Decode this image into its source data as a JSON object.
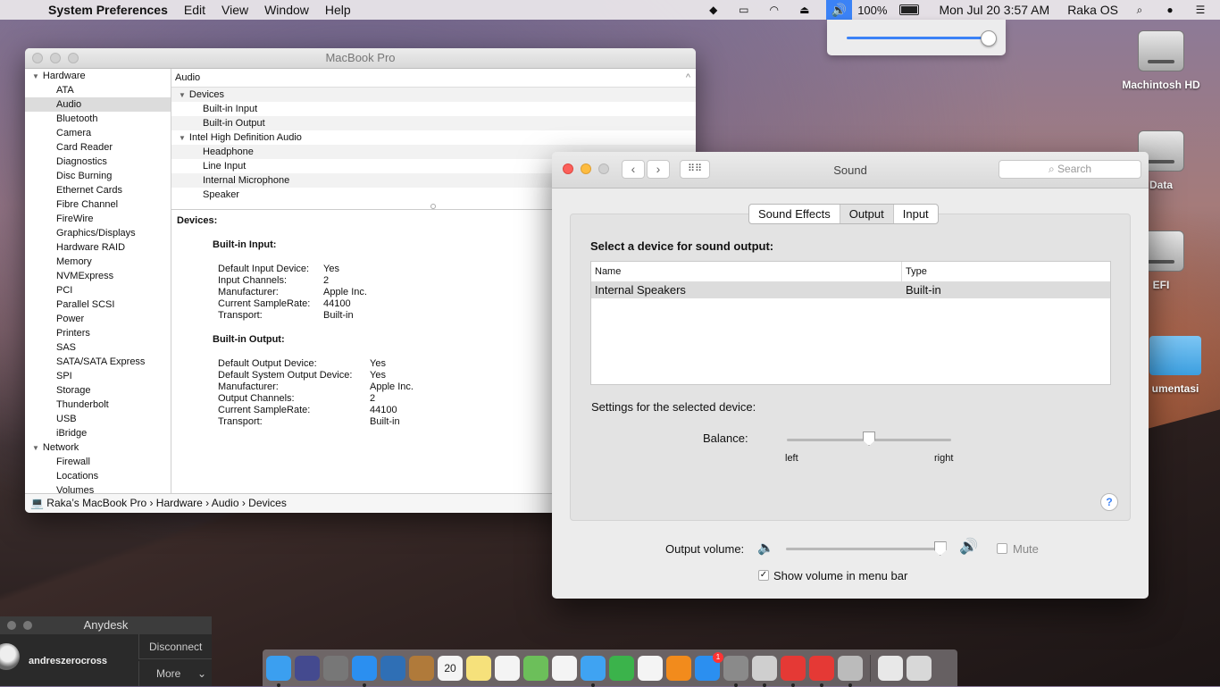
{
  "menubar": {
    "app_name": "System Preferences",
    "menus": [
      "Edit",
      "View",
      "Window",
      "Help"
    ],
    "battery_percent": "100%",
    "clock": "Mon Jul 20  3:57 AM",
    "user": "Raka OS"
  },
  "volume_popup": {
    "level_fraction": 0.97
  },
  "desktop_icons": [
    {
      "label": "Machintosh HD"
    },
    {
      "label": "Data"
    },
    {
      "label": "EFI"
    },
    {
      "label": "umentasi"
    }
  ],
  "sysinfo": {
    "title": "MacBook Pro",
    "sidebar": [
      {
        "label": "Hardware",
        "group": true
      },
      {
        "label": "ATA"
      },
      {
        "label": "Audio",
        "selected": true
      },
      {
        "label": "Bluetooth"
      },
      {
        "label": "Camera"
      },
      {
        "label": "Card Reader"
      },
      {
        "label": "Diagnostics"
      },
      {
        "label": "Disc Burning"
      },
      {
        "label": "Ethernet Cards"
      },
      {
        "label": "Fibre Channel"
      },
      {
        "label": "FireWire"
      },
      {
        "label": "Graphics/Displays"
      },
      {
        "label": "Hardware RAID"
      },
      {
        "label": "Memory"
      },
      {
        "label": "NVMExpress"
      },
      {
        "label": "PCI"
      },
      {
        "label": "Parallel SCSI"
      },
      {
        "label": "Power"
      },
      {
        "label": "Printers"
      },
      {
        "label": "SAS"
      },
      {
        "label": "SATA/SATA Express"
      },
      {
        "label": "SPI"
      },
      {
        "label": "Storage"
      },
      {
        "label": "Thunderbolt"
      },
      {
        "label": "USB"
      },
      {
        "label": "iBridge"
      },
      {
        "label": "Network",
        "group": true
      },
      {
        "label": "Firewall"
      },
      {
        "label": "Locations"
      },
      {
        "label": "Volumes"
      }
    ],
    "pane_header": "Audio",
    "tree": [
      {
        "label": "Devices",
        "group": true
      },
      {
        "label": "Built-in Input"
      },
      {
        "label": "Built-in Output"
      },
      {
        "label": "Intel High Definition Audio",
        "group": true
      },
      {
        "label": "Headphone"
      },
      {
        "label": "Line Input"
      },
      {
        "label": "Internal Microphone"
      },
      {
        "label": "Speaker"
      }
    ],
    "detail": {
      "heading": "Devices:",
      "input_title": "Built-in Input:",
      "input_rows": [
        {
          "k": "Default Input Device:",
          "v": "Yes"
        },
        {
          "k": "Input Channels:",
          "v": "2"
        },
        {
          "k": "Manufacturer:",
          "v": "Apple Inc."
        },
        {
          "k": "Current SampleRate:",
          "v": "44100"
        },
        {
          "k": "Transport:",
          "v": "Built-in"
        }
      ],
      "output_title": "Built-in Output:",
      "output_rows": [
        {
          "k": "Default Output Device:",
          "v": "Yes"
        },
        {
          "k": "Default System Output Device:",
          "v": "Yes"
        },
        {
          "k": "Manufacturer:",
          "v": "Apple Inc."
        },
        {
          "k": "Output Channels:",
          "v": "2"
        },
        {
          "k": "Current SampleRate:",
          "v": "44100"
        },
        {
          "k": "Transport:",
          "v": "Built-in"
        }
      ]
    },
    "pathbar": "Raka’s MacBook Pro  ›  Hardware  ›  Audio  ›  Devices"
  },
  "sound": {
    "title": "Sound",
    "search_placeholder": "Search",
    "tabs": [
      {
        "label": "Sound Effects"
      },
      {
        "label": "Output",
        "active": true
      },
      {
        "label": "Input"
      }
    ],
    "lead": "Select a device for sound output:",
    "columns": [
      "Name",
      "Type"
    ],
    "devices": [
      {
        "name": "Internal Speakers",
        "type": "Built-in"
      }
    ],
    "settings_label": "Settings for the selected device:",
    "balance_label": "Balance:",
    "balance_left": "left",
    "balance_right": "right",
    "balance_fraction": 0.5,
    "help": "?",
    "output_volume_label": "Output volume:",
    "output_volume_fraction": 0.97,
    "mute_label": "Mute",
    "mute_checked": false,
    "show_in_menubar_label": "Show volume in menu bar",
    "show_in_menubar_checked": true
  },
  "anydesk": {
    "title": "Anydesk",
    "user": "andreszerocross",
    "disconnect": "Disconnect",
    "more": "More"
  },
  "dock": {
    "calendar_day": "20",
    "appstore_badge": "1",
    "icons": [
      {
        "name": "finder-icon",
        "color": "#3b9ff0"
      },
      {
        "name": "siri-icon",
        "color": "#444a8f"
      },
      {
        "name": "launchpad-icon",
        "color": "#777"
      },
      {
        "name": "safari-icon",
        "color": "#2b8ff0"
      },
      {
        "name": "preview-icon",
        "color": "#2f6fb5"
      },
      {
        "name": "contacts-icon",
        "color": "#b07a3a"
      },
      {
        "name": "calendar-icon",
        "color": "#f4f4f4"
      },
      {
        "name": "notes-icon",
        "color": "#f6e17b"
      },
      {
        "name": "reminders-icon",
        "color": "#f4f4f4"
      },
      {
        "name": "maps-icon",
        "color": "#6cbf5a"
      },
      {
        "name": "photos-icon",
        "color": "#f4f4f4"
      },
      {
        "name": "messages-icon",
        "color": "#3fa3f2"
      },
      {
        "name": "facetime-icon",
        "color": "#3bb34b"
      },
      {
        "name": "itunes-icon",
        "color": "#f4f4f4"
      },
      {
        "name": "ibooks-icon",
        "color": "#f28b1c"
      },
      {
        "name": "appstore-icon",
        "color": "#2b8ff0"
      },
      {
        "name": "system-preferences-icon",
        "color": "#8a8a8a"
      },
      {
        "name": "system-information-icon",
        "color": "#cfcfcf"
      },
      {
        "name": "anydesk-icon",
        "color": "#e53935"
      },
      {
        "name": "anydesk-alt-icon",
        "color": "#e53935"
      },
      {
        "name": "disk-utility-icon",
        "color": "#bbb"
      },
      {
        "name": "documents-icon",
        "color": "#e8e8e8"
      },
      {
        "name": "trash-icon",
        "color": "#d8d8d8"
      }
    ]
  }
}
